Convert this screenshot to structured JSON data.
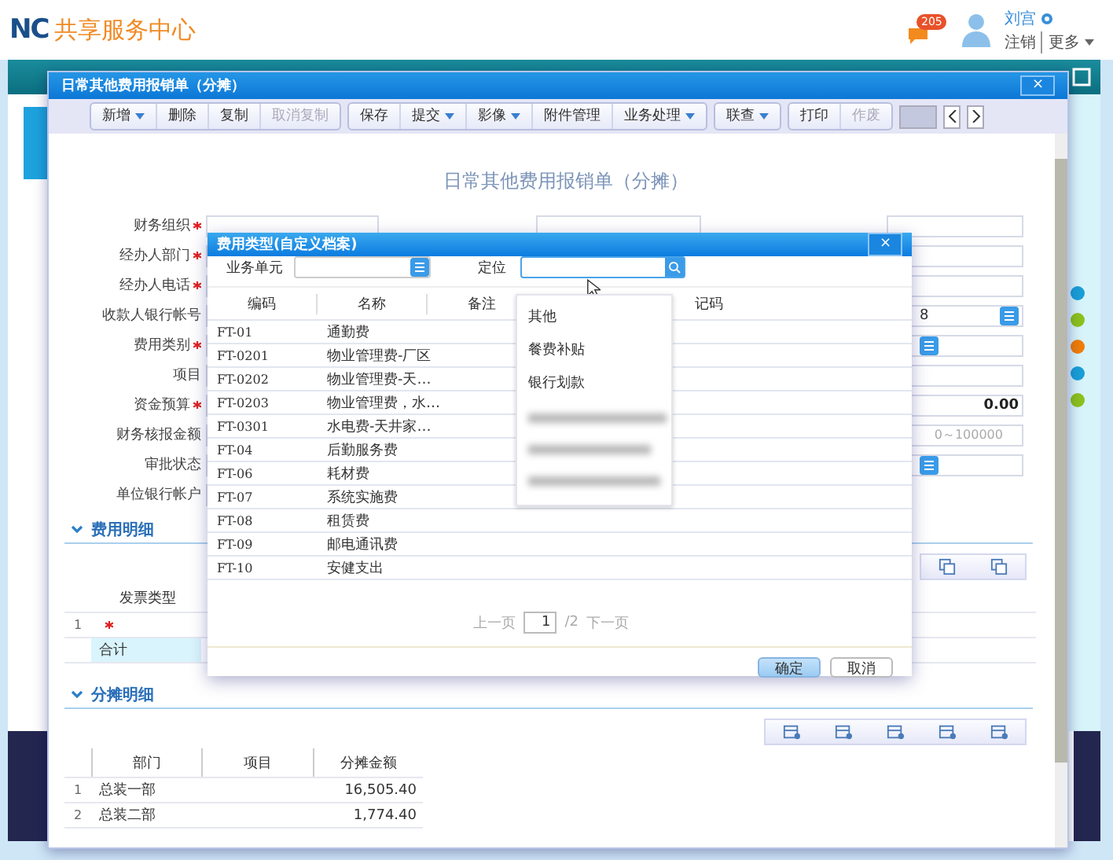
{
  "header": {
    "logo": "NC",
    "title": "共享服务中心",
    "badge": "205",
    "user": "刘宫",
    "links": [
      "注销",
      "更多"
    ]
  },
  "side_dots": [
    {
      "color": "#1a9fd8"
    },
    {
      "color": "#8cc21e"
    },
    {
      "color": "#f07d0a"
    },
    {
      "color": "#1a9fd8"
    },
    {
      "color": "#8cc21e"
    }
  ],
  "window": {
    "title": "日常其他费用报销单（分摊）",
    "close": "×"
  },
  "toolbar": [
    [
      {
        "label": "新增",
        "dropdown": true,
        "disabled": false
      },
      {
        "label": "删除",
        "dropdown": false,
        "disabled": false
      },
      {
        "label": "复制",
        "dropdown": false,
        "disabled": false
      },
      {
        "label": "取消复制",
        "dropdown": false,
        "disabled": true
      }
    ],
    [
      {
        "label": "保存",
        "dropdown": false,
        "disabled": false
      },
      {
        "label": "提交",
        "dropdown": true,
        "disabled": false
      },
      {
        "label": "影像",
        "dropdown": true,
        "disabled": false
      },
      {
        "label": "附件管理",
        "dropdown": false,
        "disabled": false
      },
      {
        "label": "业务处理",
        "dropdown": true,
        "disabled": false
      }
    ],
    [
      {
        "label": "联查",
        "dropdown": true,
        "disabled": false
      }
    ],
    [
      {
        "label": "打印",
        "dropdown": false,
        "disabled": false
      },
      {
        "label": "作废",
        "dropdown": false,
        "disabled": true
      }
    ]
  ],
  "form": {
    "title": "日常其他费用报销单（分摊）",
    "rows": [
      {
        "left": {
          "label": "财务组织",
          "required": true
        },
        "mid_field": true,
        "right": {
          "kind": "text"
        }
      },
      {
        "left": {
          "label": "经办人部门",
          "required": true
        },
        "right": {
          "kind": "text"
        }
      },
      {
        "left": {
          "label": "经办人电话",
          "required": true
        },
        "right": {
          "kind": "text"
        }
      },
      {
        "left": {
          "label": "收款人银行帐号",
          "required": false
        },
        "right": {
          "kind": "ref",
          "value": "8"
        }
      },
      {
        "left": {
          "label": "费用类别",
          "required": true
        },
        "right": {
          "kind": "ref"
        }
      },
      {
        "left": {
          "label": "项目",
          "required": false
        },
        "right": {
          "kind": "text"
        }
      },
      {
        "left": {
          "label": "资金预算",
          "required": true
        },
        "right": {
          "kind": "number",
          "value": "0.00"
        }
      },
      {
        "left": {
          "label": "财务核报金额",
          "required": false
        },
        "right": {
          "kind": "number",
          "placeholder": "0～100000"
        }
      },
      {
        "left": {
          "label": "审批状态",
          "required": false
        },
        "right": {
          "kind": "ref"
        }
      },
      {
        "left": {
          "label": "单位银行帐户",
          "required": false
        }
      }
    ]
  },
  "expense_section": {
    "title": "费用明细",
    "expanded": true,
    "columns": [
      "发票类型"
    ],
    "rows": [
      {
        "index": "1",
        "required": true
      }
    ],
    "total_label": "合计"
  },
  "allocation_section": {
    "title": "分摊明细",
    "expanded": true,
    "columns": [
      "部门",
      "项目",
      "分摊金额"
    ],
    "rows": [
      {
        "index": "1",
        "department": "总装一部",
        "amount": "16,505.40"
      },
      {
        "index": "2",
        "department": "总装二部",
        "amount": "1,774.40"
      }
    ]
  },
  "dialog": {
    "title": "费用类型(自定义档案)",
    "close": "×",
    "unit_label": "业务单元",
    "locate_label": "定位",
    "columns": [
      "编码",
      "名称",
      "备注",
      "记码"
    ],
    "rows": [
      {
        "code": "FT-01",
        "name": "通勤费"
      },
      {
        "code": "FT-0201",
        "name": "物业管理费-厂区"
      },
      {
        "code": "FT-0202",
        "name": "物业管理费-天…"
      },
      {
        "code": "FT-0203",
        "name": "物业管理费，水…"
      },
      {
        "code": "FT-0301",
        "name": "水电费-天井家…"
      },
      {
        "code": "FT-04",
        "name": "后勤服务费"
      },
      {
        "code": "FT-06",
        "name": "耗材费"
      },
      {
        "code": "FT-07",
        "name": "系统实施费"
      },
      {
        "code": "FT-08",
        "name": "租赁费"
      },
      {
        "code": "FT-09",
        "name": "邮电通讯费"
      },
      {
        "code": "FT-10",
        "name": "安健支出"
      }
    ],
    "pager": {
      "prev": "上一页",
      "page": "1",
      "total": "/2",
      "next": "下一页"
    },
    "buttons": [
      {
        "label": "确定",
        "primary": true
      },
      {
        "label": "取消",
        "primary": false
      }
    ]
  },
  "dropdown": {
    "items": [
      "其他",
      "餐费补贴",
      "银行划款"
    ]
  }
}
